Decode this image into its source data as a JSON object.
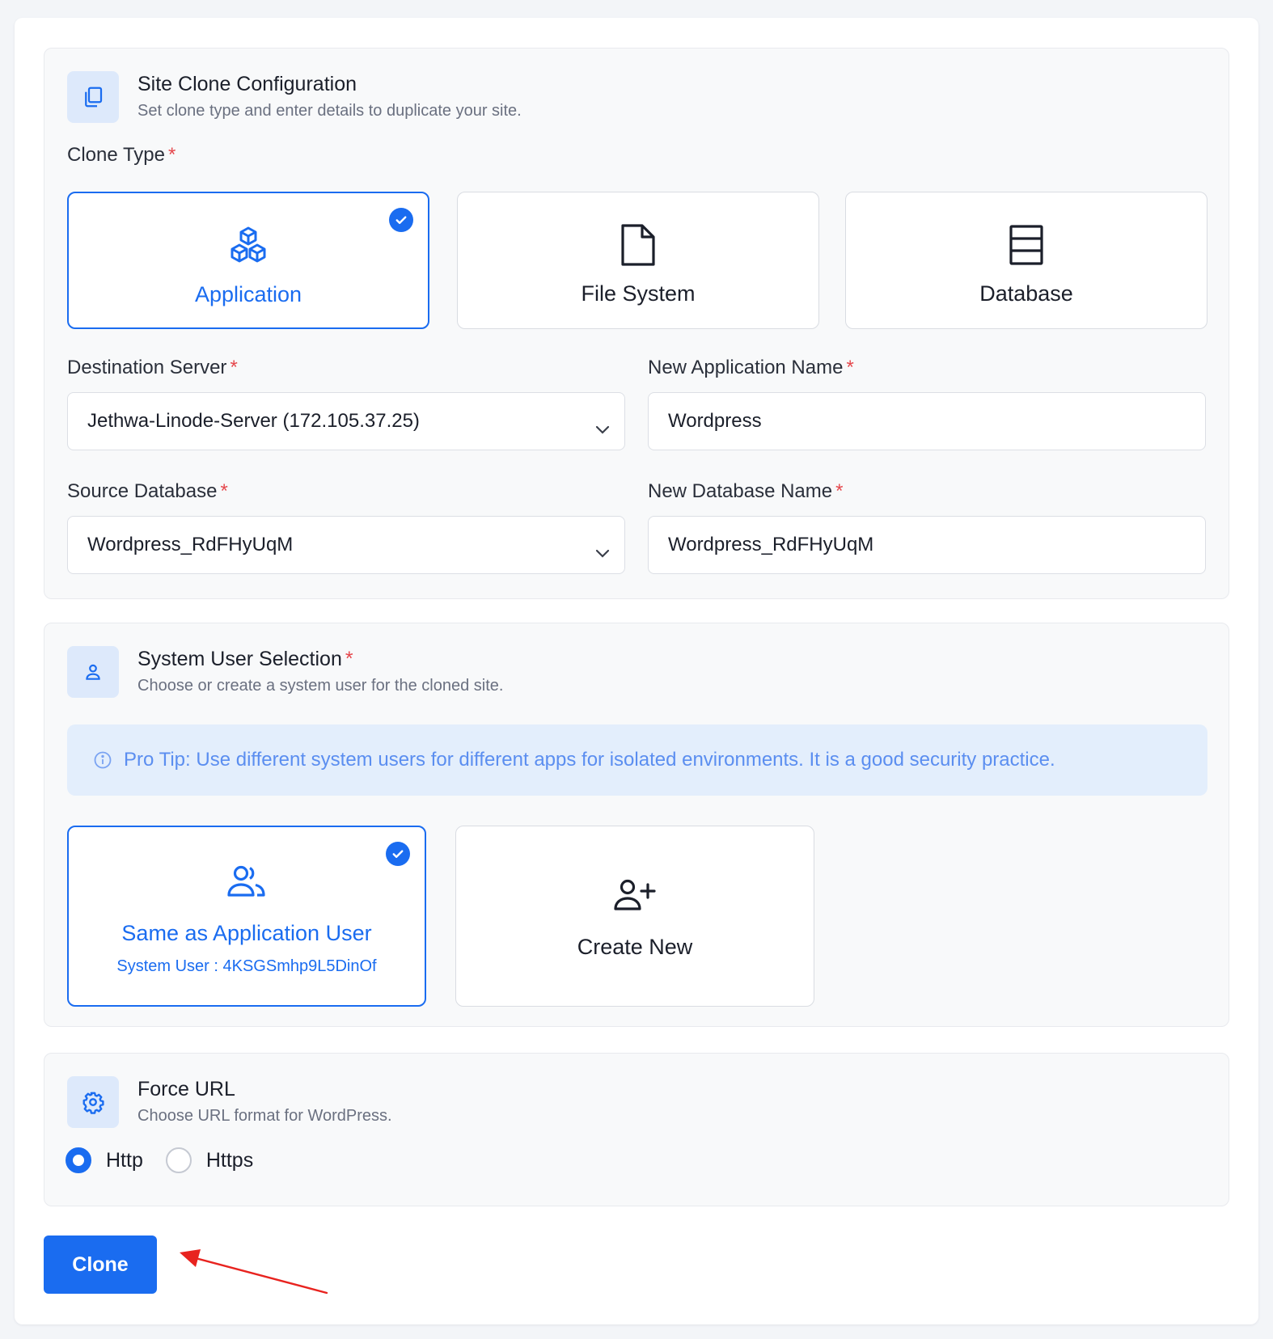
{
  "config": {
    "title": "Site Clone Configuration",
    "subtitle": "Set clone type and enter details to duplicate your site.",
    "icon": "copy-icon",
    "clone_type_label": "Clone Type",
    "required_mark": "*",
    "clone_types": [
      {
        "label": "Application",
        "icon": "cubes-icon",
        "selected": true
      },
      {
        "label": "File System",
        "icon": "file-icon",
        "selected": false
      },
      {
        "label": "Database",
        "icon": "database-icon",
        "selected": false
      }
    ],
    "destination_server": {
      "label": "Destination Server",
      "value": "Jethwa-Linode-Server (172.105.37.25)"
    },
    "new_app_name": {
      "label": "New Application Name",
      "value": "Wordpress"
    },
    "source_database": {
      "label": "Source Database",
      "value": "Wordpress_RdFHyUqM"
    },
    "new_db_name": {
      "label": "New Database Name",
      "value": "Wordpress_RdFHyUqM"
    }
  },
  "system_user": {
    "title": "System User Selection",
    "subtitle": "Choose or create a system user for the cloned site.",
    "icon": "user-icon",
    "tip": "Pro Tip: Use different system users for different apps for isolated environments. It is a good security practice.",
    "options": [
      {
        "label": "Same as Application User",
        "sub": "System User : 4KSGSmhp9L5DinOf",
        "icon": "users-icon",
        "selected": true
      },
      {
        "label": "Create New",
        "icon": "user-plus-icon",
        "selected": false
      }
    ]
  },
  "force_url": {
    "title": "Force URL",
    "subtitle": "Choose URL format for WordPress.",
    "icon": "gear-icon",
    "options": [
      {
        "label": "Http",
        "selected": true
      },
      {
        "label": "Https",
        "selected": false
      }
    ]
  },
  "actions": {
    "clone_label": "Clone"
  },
  "colors": {
    "accent": "#1a6cf0",
    "required": "#e5484d",
    "tip_bg": "#e3eefc",
    "annotation_arrow": "#e8231f"
  }
}
